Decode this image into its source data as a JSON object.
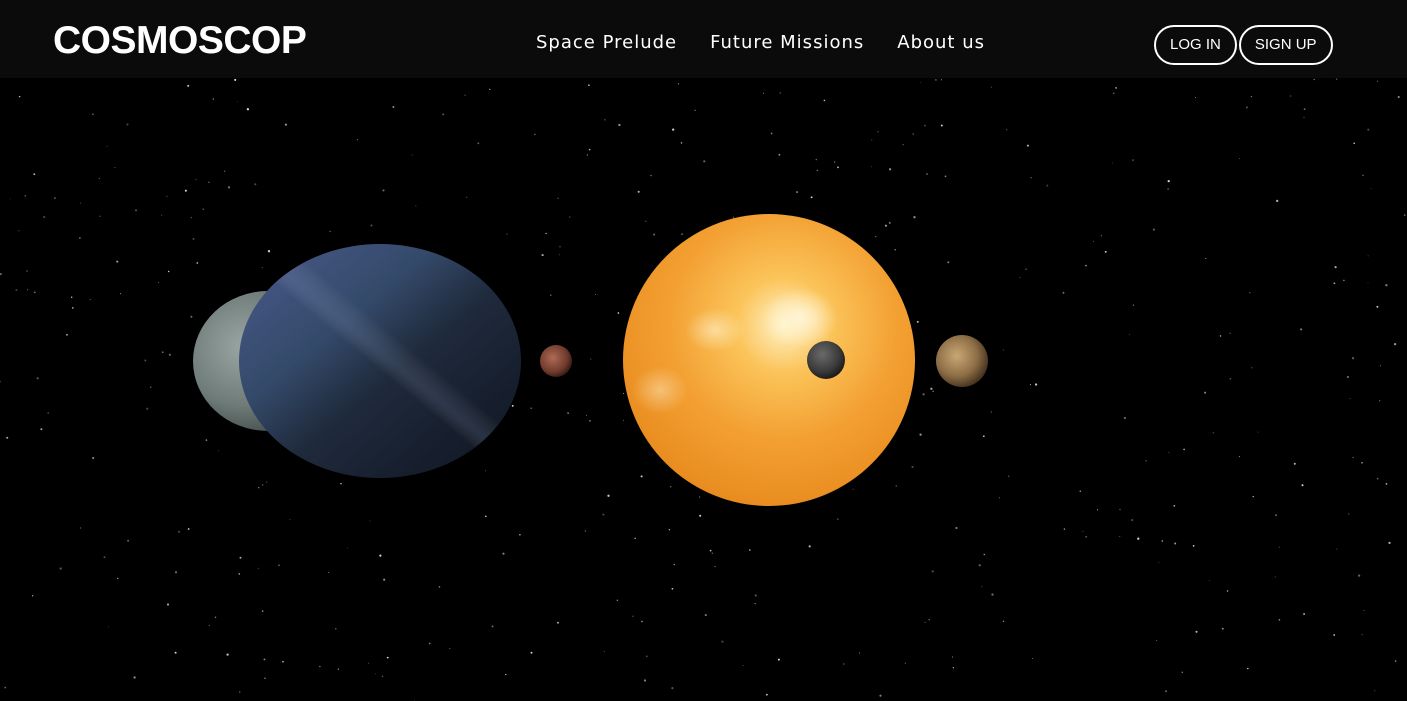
{
  "brand": {
    "logo_text": "COSMOSCOP"
  },
  "nav": {
    "items": [
      {
        "label": "Space Prelude"
      },
      {
        "label": "Future Missions"
      },
      {
        "label": "About us"
      }
    ]
  },
  "auth": {
    "login_label": "LOG IN",
    "signup_label": "SIGN UP"
  },
  "scene": {
    "background_color": "#000000",
    "bodies": [
      {
        "name": "pale-gray-planet",
        "color": "#7d8a88"
      },
      {
        "name": "blue-planet",
        "color": "#3a4a6e"
      },
      {
        "name": "small-red-planet",
        "color": "#8a4a3a"
      },
      {
        "name": "sun",
        "color": "#f4a330"
      },
      {
        "name": "dark-moon",
        "color": "#444444"
      },
      {
        "name": "brown-planet",
        "color": "#9a7a52"
      }
    ]
  },
  "colors": {
    "nav_bg": "#0b0b0b",
    "text": "#ffffff"
  }
}
